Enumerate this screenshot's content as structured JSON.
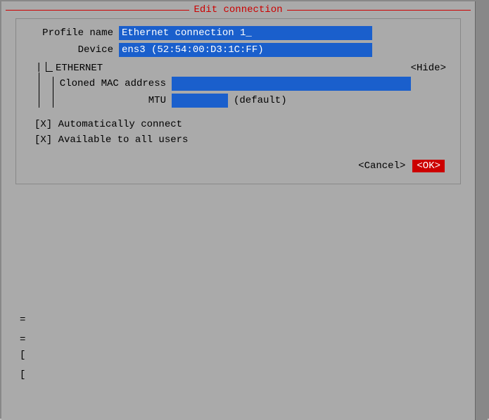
{
  "title": "Edit connection",
  "form": {
    "profile_name_label": "Profile name",
    "profile_name_value": "Ethernet connection 1_",
    "device_label": "Device",
    "device_value": "ens3 (52:54:00:D3:1C:FF)"
  },
  "ethernet_section": {
    "title": "ETHERNET",
    "hide_button": "<Hide>",
    "cloned_mac_label": "Cloned MAC address",
    "cloned_mac_value": "",
    "mtu_label": "MTU",
    "mtu_value": "",
    "mtu_default": "(default)"
  },
  "checkboxes": {
    "auto_connect_label": "[X] Automatically connect",
    "all_users_label": "[X] Available to all users"
  },
  "buttons": {
    "cancel_label": "<Cancel>",
    "ok_label": "<OK>"
  },
  "bottom_lines": {
    "line1": "=",
    "line2": "=",
    "bracket1": "[",
    "bracket2": "["
  }
}
